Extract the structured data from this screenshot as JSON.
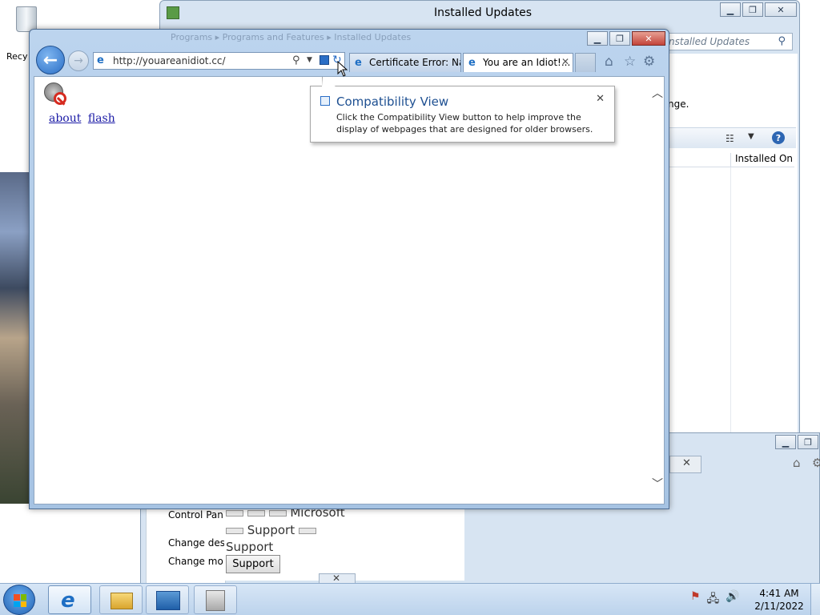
{
  "desktop": {
    "recycle_bin_label": "Recy"
  },
  "updates_window": {
    "title": "Installed Updates",
    "search_placeholder": "nstalled Updates",
    "change_text": "nge.",
    "column_installed_on": "Installed On",
    "minimize": "▁",
    "maximize": "❐",
    "close": "✕"
  },
  "lower_window": {
    "control_panel_item": "Control Pan",
    "change_item_1": "Change des",
    "change_item_2": "Change mo",
    "microsoft_text": "Microsoft",
    "support_text_1": "Support",
    "support_text_2": "Support",
    "support_button": "Support",
    "tab_close": "✕",
    "mini_close": "✕"
  },
  "browser": {
    "url": "http://youareanidiot.cc/",
    "ghost_crumbs": "Programs  ▸  Programs and Features  ▸  Installed Updates",
    "tabs": [
      {
        "label": "Certificate Error: Na..."
      },
      {
        "label": "You are an Idiot!..."
      }
    ],
    "tab_close": "✕",
    "links": [
      "about",
      "flash"
    ],
    "minimize": "▁",
    "maximize": "❐",
    "close": "✕"
  },
  "tooltip": {
    "title": "Compatibility View",
    "body": "Click the Compatibility View button to help improve the display of webpages that are designed for older browsers.",
    "close": "✕"
  },
  "taskbar": {
    "time": "4:41 AM",
    "date": "2/11/2022"
  },
  "colors": {
    "accent": "#1f6fc4",
    "link": "#1a1aa6",
    "tooltip_title": "#1d4f91",
    "close_button": "#c3443a"
  }
}
